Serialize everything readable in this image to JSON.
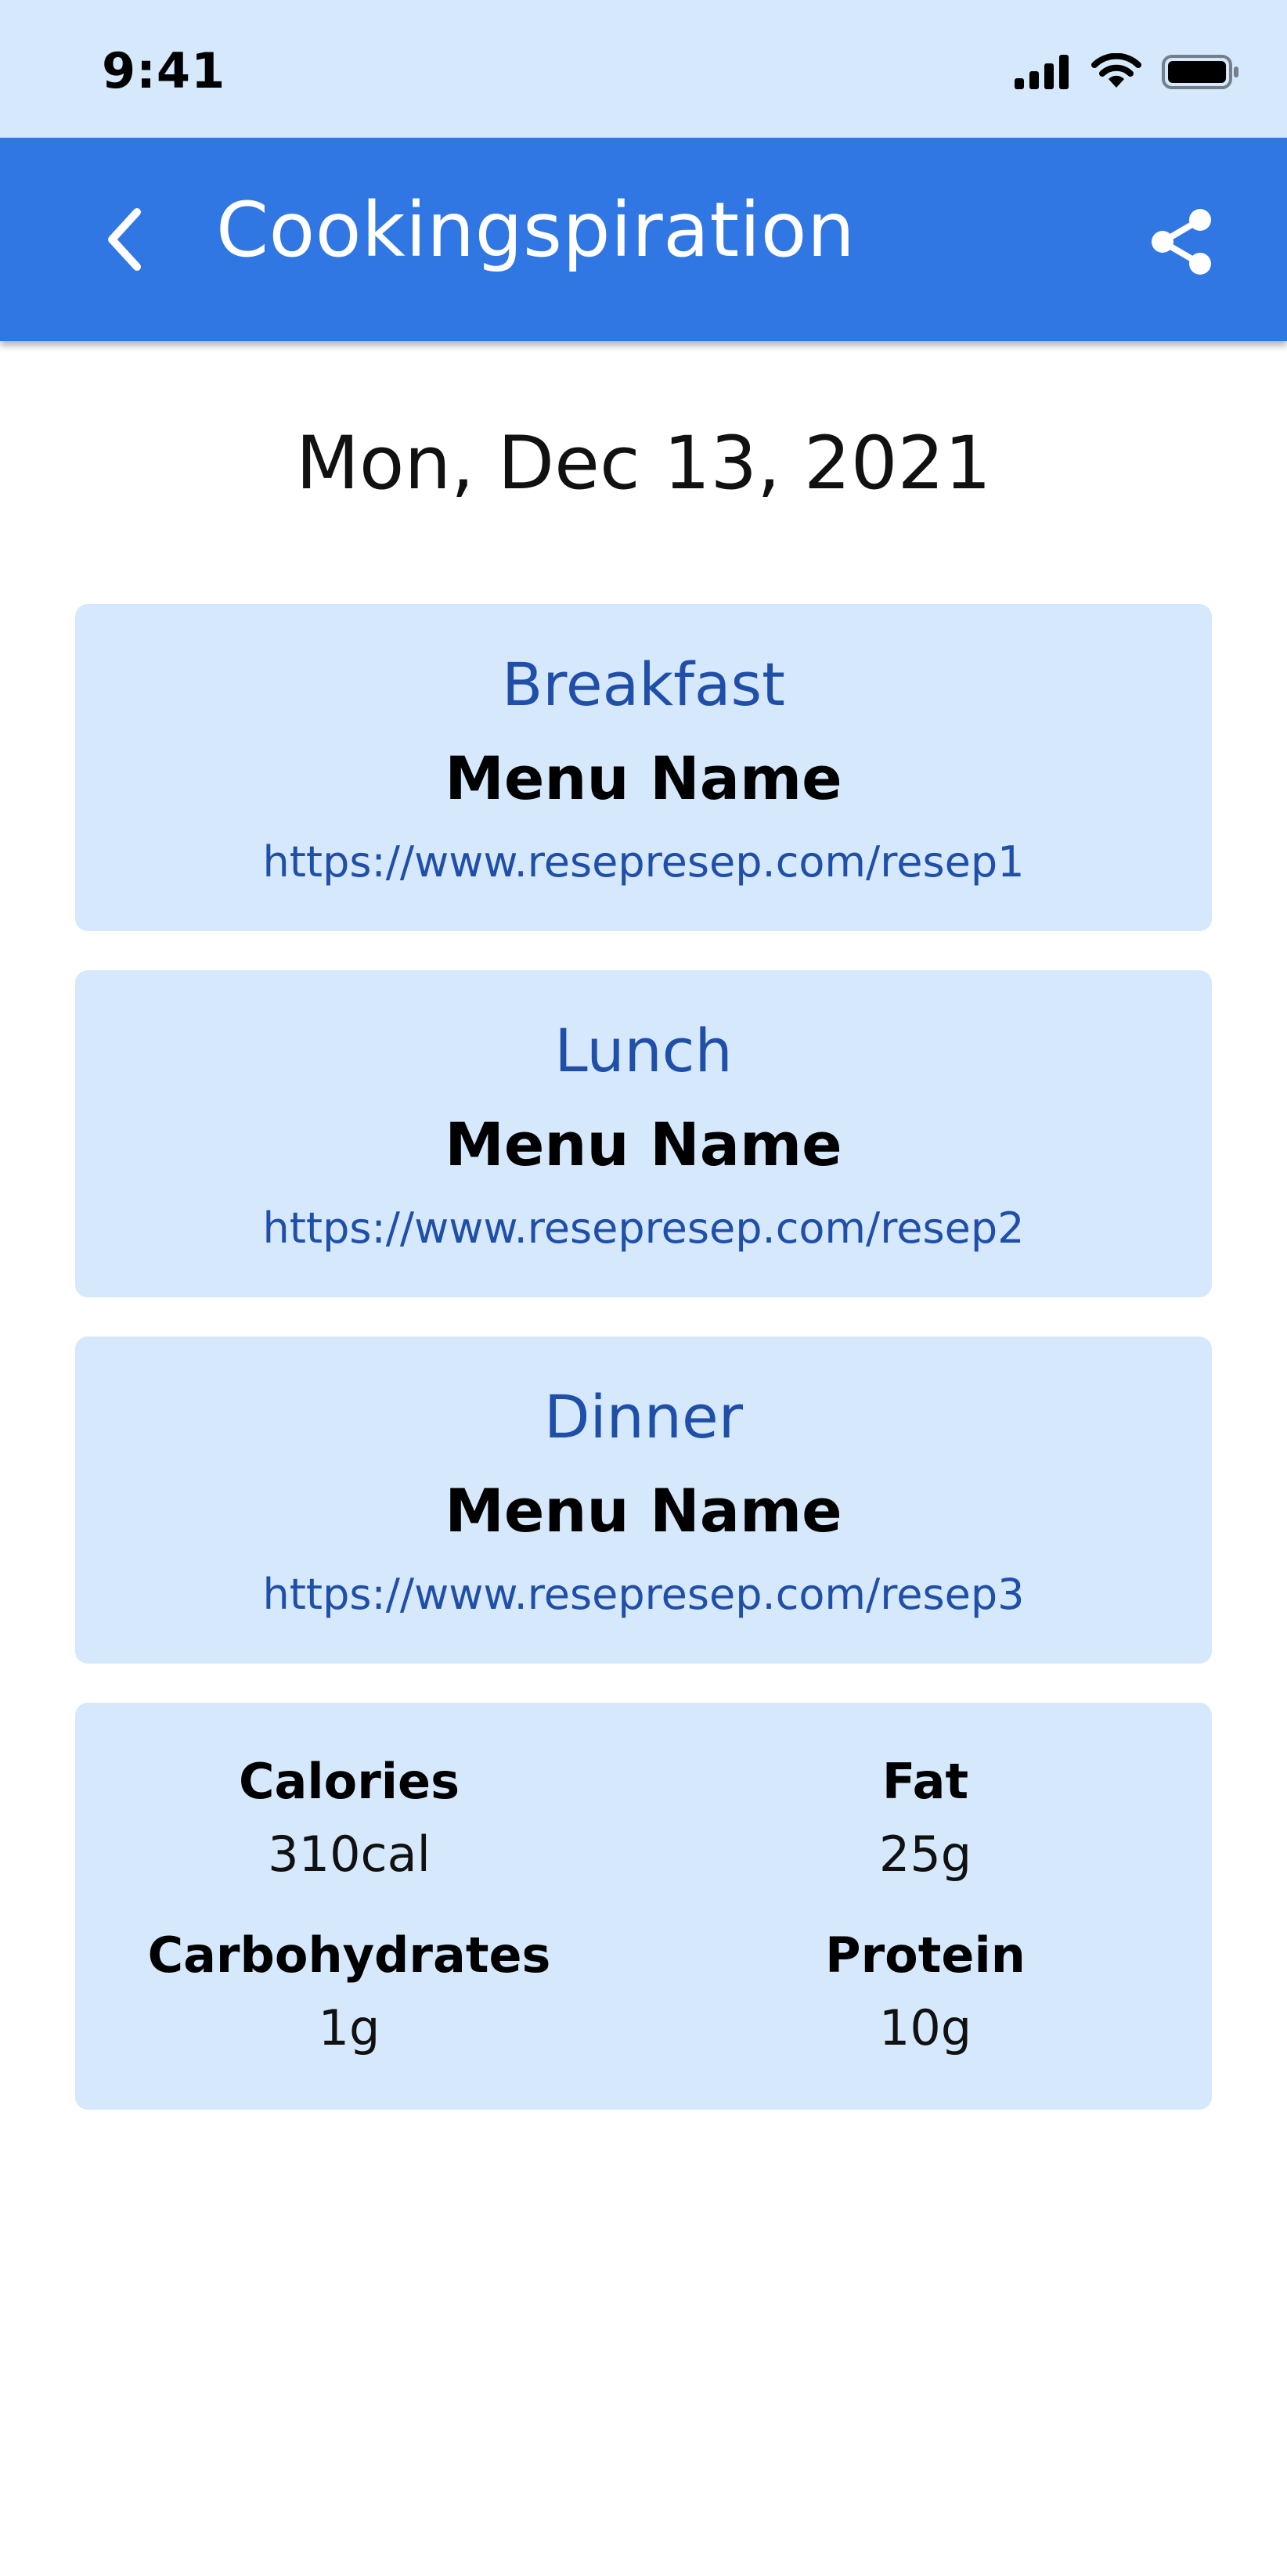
{
  "status_bar": {
    "time": "9:41",
    "icons": [
      "signal-icon",
      "wifi-icon",
      "battery-icon"
    ]
  },
  "app_bar": {
    "title": "Cookingspiration",
    "back_icon": "chevron-left-icon",
    "share_icon": "share-icon",
    "background_color": "#3077e3"
  },
  "date": "Mon, Dec 13, 2021",
  "meals": [
    {
      "type": "Breakfast",
      "name": "Menu Name",
      "url": "https://www.resepresep.com/resep1"
    },
    {
      "type": "Lunch",
      "name": "Menu Name",
      "url": "https://www.resepresep.com/resep2"
    },
    {
      "type": "Dinner",
      "name": "Menu Name",
      "url": "https://www.resepresep.com/resep3"
    }
  ],
  "nutrition": [
    {
      "label": "Calories",
      "value": "310cal"
    },
    {
      "label": "Fat",
      "value": "25g"
    },
    {
      "label": "Carbohydrates",
      "value": "1g"
    },
    {
      "label": "Protein",
      "value": "10g"
    }
  ],
  "colors": {
    "card_background": "#d5e8fc",
    "accent_text": "#1f4fa8"
  }
}
